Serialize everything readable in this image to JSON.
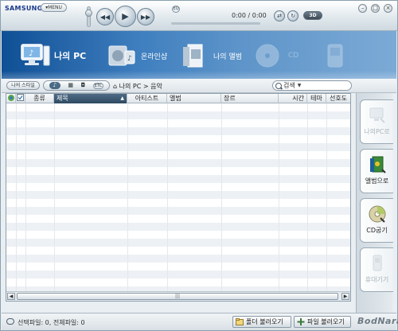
{
  "titlebar": {
    "brand": "SAMSUNG",
    "menu_label": "MENU",
    "time": "0:00 / 0:00",
    "toggle_label": "3D",
    "eq_label": "EQ"
  },
  "nav": [
    {
      "label": "나의 PC"
    },
    {
      "label": "온라인샵"
    },
    {
      "label": "나의 앨범"
    },
    {
      "label": "CD"
    },
    {
      "label": ""
    }
  ],
  "toolbar": {
    "my_style": "나의 스타일",
    "categories": [
      "♪",
      "▦",
      "◘",
      "ETC"
    ],
    "breadcrumb": "나의 PC > 음악",
    "search_label": "검색"
  },
  "table": {
    "columns": [
      "",
      "",
      "종류",
      "제목",
      "아티스트",
      "앨범",
      "장르",
      "시간",
      "테마",
      "선호도"
    ],
    "sorted_column": "제목",
    "rows": []
  },
  "side_tabs": [
    {
      "label": "나의PC로"
    },
    {
      "label": "앨범으로"
    },
    {
      "label": "CD굽기"
    },
    {
      "label": "휴대기기"
    }
  ],
  "status": {
    "text": "선택파일: 0, 전체파일: 0",
    "folder_button": "폴더 불러오기",
    "file_button": "파일 불러오기",
    "watermark": "BodNara"
  },
  "colors": {
    "nav_dark": "#0f4f95",
    "nav_light": "#7caad6",
    "row_alt": "#edf1f5"
  }
}
